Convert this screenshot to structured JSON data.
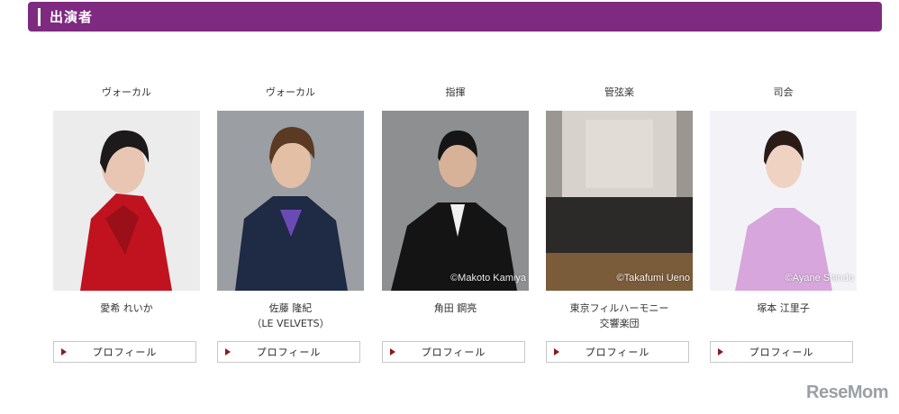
{
  "section": {
    "title": "出演者"
  },
  "performers": [
    {
      "role": "ヴォーカル",
      "name_line1": "愛希 れいか",
      "name_line2": "",
      "credit": "",
      "button": "プロフィール"
    },
    {
      "role": "ヴォーカル",
      "name_line1": "佐藤 隆紀",
      "name_line2": "（LE VELVETS）",
      "credit": "",
      "button": "プロフィール"
    },
    {
      "role": "指揮",
      "name_line1": "角田 鋼亮",
      "name_line2": "",
      "credit": "©Makoto Kamiya",
      "button": "プロフィール"
    },
    {
      "role": "管弦楽",
      "name_line1": "東京フィルハーモニー",
      "name_line2": "交響楽団",
      "credit": "©Takafumi Ueno",
      "button": "プロフィール"
    },
    {
      "role": "司会",
      "name_line1": "塚本 江里子",
      "name_line2": "",
      "credit": "©Ayane Shindo",
      "button": "プロフィール"
    }
  ],
  "watermark": {
    "logo": "ReseMom"
  },
  "colors": {
    "section_bar": "#7e2a80",
    "button_arrow": "#8b1a1a"
  }
}
